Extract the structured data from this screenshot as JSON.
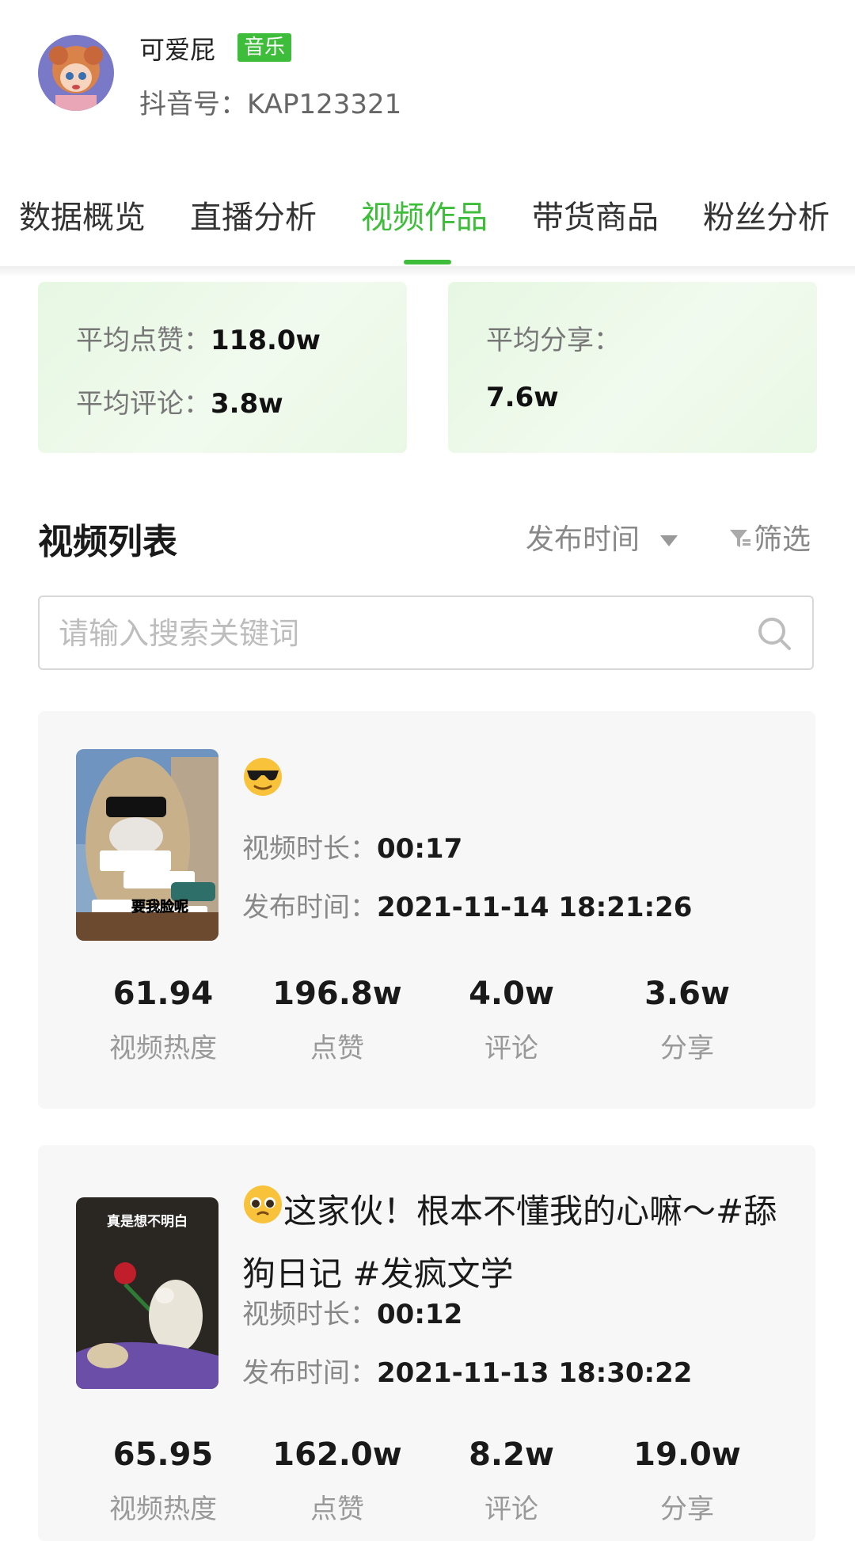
{
  "profile": {
    "name": "可爱屁",
    "tag": "音乐",
    "douyin_id": "抖音号：KAP123321"
  },
  "tabs": [
    {
      "label": "数据概览",
      "active": false
    },
    {
      "label": "直播分析",
      "active": false
    },
    {
      "label": "视频作品",
      "active": true
    },
    {
      "label": "带货商品",
      "active": false
    },
    {
      "label": "粉丝分析",
      "active": false
    }
  ],
  "stats": {
    "avg_likes_label": "平均点赞：",
    "avg_likes_value": "118.0w",
    "avg_comments_label": "平均评论：",
    "avg_comments_value": "3.8w",
    "avg_shares_label": "平均分享：",
    "avg_shares_value": "7.6w"
  },
  "list": {
    "title": "视频列表",
    "sort_label": "发布时间",
    "filter_label": "筛选",
    "search_placeholder": "请输入搜索关键词"
  },
  "labels": {
    "duration": "视频时长：",
    "publish_time": "发布时间："
  },
  "videos": [
    {
      "emoji": "sunglasses-emoji",
      "title": "",
      "duration": "00:17",
      "publish_time": "2021-11-14 18:21:26",
      "metrics": [
        {
          "value": "61.94",
          "label": "视频热度"
        },
        {
          "value": "196.8w",
          "label": "点赞"
        },
        {
          "value": "4.0w",
          "label": "评论"
        },
        {
          "value": "3.6w",
          "label": "分享"
        }
      ],
      "thumb_caption": "要我脸呢"
    },
    {
      "emoji": "pleading-face-emoji",
      "title": "这家伙！根本不懂我的心嘛～#舔狗日记 #发疯文学",
      "duration": "00:12",
      "publish_time": "2021-11-13 18:30:22",
      "metrics": [
        {
          "value": "65.95",
          "label": "视频热度"
        },
        {
          "value": "162.0w",
          "label": "点赞"
        },
        {
          "value": "8.2w",
          "label": "评论"
        },
        {
          "value": "19.0w",
          "label": "分享"
        }
      ],
      "thumb_caption": "真是想不明白"
    }
  ],
  "colors": {
    "accent": "#3ebd3a",
    "card_bg": "#f7f7f7",
    "stat_bg": "#e6f7e2"
  }
}
